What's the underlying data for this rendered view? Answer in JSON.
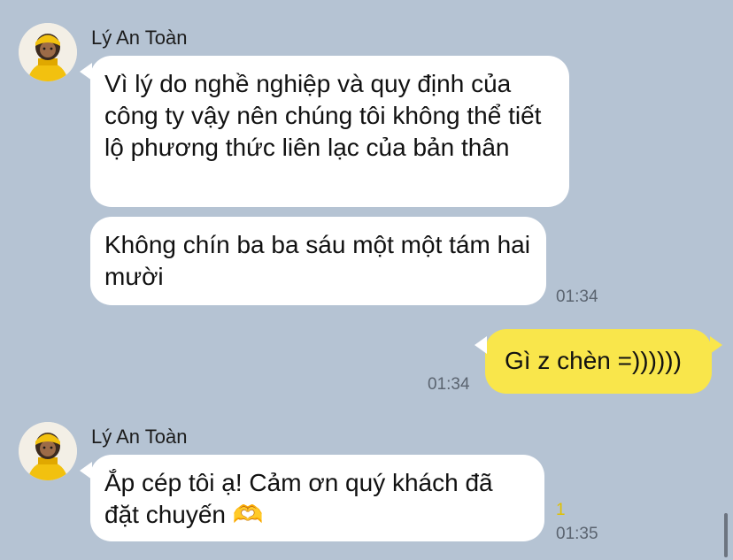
{
  "messages": [
    {
      "sender": "Lý An Toàn",
      "text": "Vì lý do nghề nghiệp và quy định của công ty vậy nên chúng tôi không thể tiết lộ phương thức liên lạc của bản thân"
    },
    {
      "text": "Không chín ba ba sáu một một tám hai mười",
      "time": "01:34"
    },
    {
      "text": "Gì z chèn =))))))",
      "time": "01:34"
    },
    {
      "sender": "Lý An Toàn",
      "text": "Ắp cép tôi ạ! Cảm ơn quý khách đã đặt chuyến 🫶",
      "unread_count": "1",
      "time": "01:35"
    }
  ],
  "colors": {
    "background": "#b5c3d3",
    "incoming_bubble": "#ffffff",
    "outgoing_bubble": "#f9e64b"
  }
}
